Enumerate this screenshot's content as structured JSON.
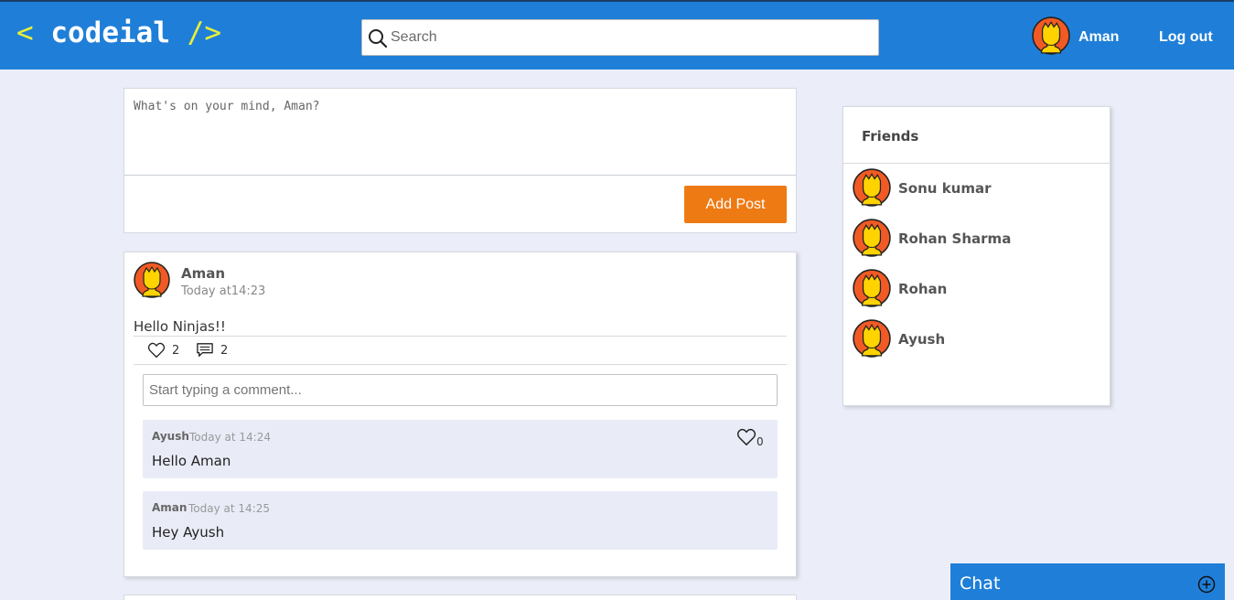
{
  "nav": {
    "logo_open": "<",
    "logo_text": "codeial",
    "logo_close": "/>",
    "search_placeholder": "Search",
    "user_name": "Aman",
    "logout_label": "Log out"
  },
  "new_post": {
    "placeholder": "What's on your mind, Aman?",
    "button_label": "Add Post"
  },
  "posts": [
    {
      "author": "Aman",
      "time": "Today at14:23",
      "content": "Hello Ninjas!!",
      "likes": "2",
      "comments_count": "2",
      "comment_placeholder": "Start typing a comment...",
      "comments": [
        {
          "author": "Ayush",
          "time": "Today at 14:24",
          "text": "Hello Aman",
          "likes": "0"
        },
        {
          "author": "Aman",
          "time": "Today at 14:25",
          "text": "Hey Ayush"
        }
      ]
    }
  ],
  "friends": {
    "title": "Friends",
    "list": [
      "Sonu kumar",
      "Rohan Sharma",
      "Rohan",
      "Ayush"
    ]
  },
  "chat": {
    "title": "Chat",
    "icon": "plus-circle-icon"
  },
  "colors": {
    "nav": "#1f7fd8",
    "accent": "#ee7a14",
    "background": "#ebeef8",
    "comment_bg": "#e9ecf7"
  }
}
